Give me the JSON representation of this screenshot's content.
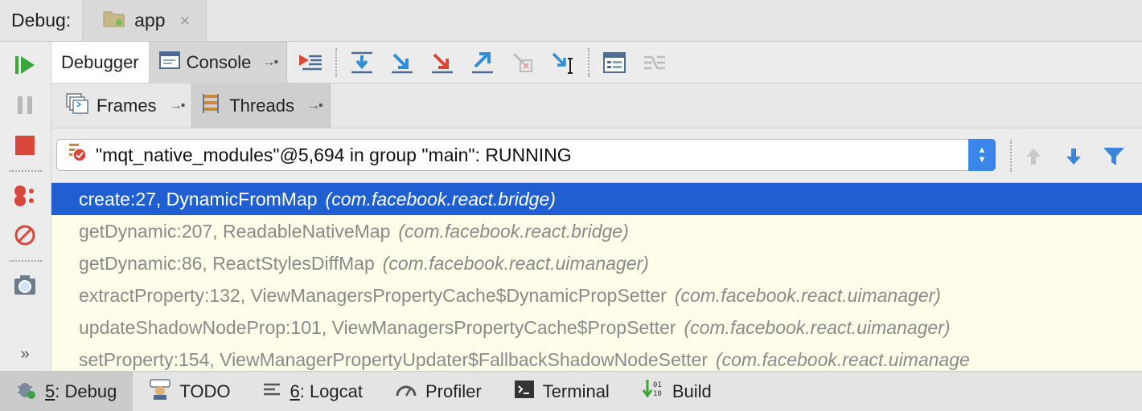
{
  "title_bar": {
    "label": "Debug:",
    "tab": "app",
    "close": "×"
  },
  "debugger_tabs": {
    "debugger": "Debugger",
    "console": "Console",
    "pin": "→▪"
  },
  "sub_tabs": {
    "frames": "Frames",
    "threads": "Threads",
    "pin": "→▪"
  },
  "thread_select": {
    "value": "\"mqt_native_modules\"@5,694 in group \"main\": RUNNING"
  },
  "frames": [
    {
      "method": "create:27, DynamicFromMap",
      "pkg": "(com.facebook.react.bridge)",
      "selected": true
    },
    {
      "method": "getDynamic:207, ReadableNativeMap",
      "pkg": "(com.facebook.react.bridge)",
      "selected": false
    },
    {
      "method": "getDynamic:86, ReactStylesDiffMap",
      "pkg": "(com.facebook.react.uimanager)",
      "selected": false
    },
    {
      "method": "extractProperty:132, ViewManagersPropertyCache$DynamicPropSetter",
      "pkg": "(com.facebook.react.uimanager)",
      "selected": false
    },
    {
      "method": "updateShadowNodeProp:101, ViewManagersPropertyCache$PropSetter",
      "pkg": "(com.facebook.react.uimanager)",
      "selected": false
    },
    {
      "method": "setProperty:154, ViewManagerPropertyUpdater$FallbackShadowNodeSetter",
      "pkg": "(com.facebook.react.uimanage",
      "selected": false
    }
  ],
  "bottom_bar": {
    "debug_num": "5",
    "debug_label": ": Debug",
    "todo": "TODO",
    "logcat_num": "6",
    "logcat_label": ": Logcat",
    "profiler": "Profiler",
    "terminal": "Terminal",
    "build": "Build"
  },
  "colors": {
    "selection": "#1f5fd1",
    "frames_bg": "#fdfde9",
    "resume_green": "#3aa53a",
    "stop_red": "#d9473b",
    "step_blue": "#2f8fd6",
    "step_red": "#d9473b"
  }
}
